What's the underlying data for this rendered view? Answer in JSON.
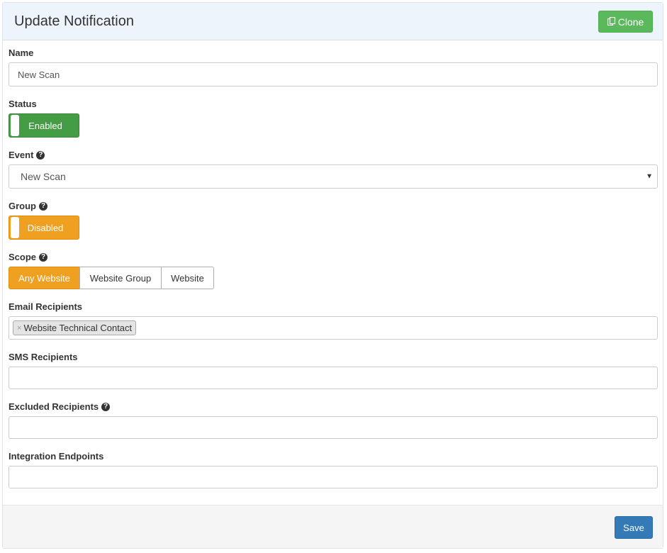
{
  "header": {
    "title": "Update Notification",
    "clone_label": "Clone"
  },
  "fields": {
    "name": {
      "label": "Name",
      "value": "New Scan"
    },
    "status": {
      "label": "Status",
      "toggle_label": "Enabled"
    },
    "event": {
      "label": "Event",
      "value": "New Scan"
    },
    "group": {
      "label": "Group",
      "toggle_label": "Disabled"
    },
    "scope": {
      "label": "Scope",
      "options": [
        "Any Website",
        "Website Group",
        "Website"
      ],
      "selected": "Any Website"
    },
    "email_recipients": {
      "label": "Email Recipients",
      "tags": [
        "Website Technical Contact"
      ]
    },
    "sms_recipients": {
      "label": "SMS Recipients"
    },
    "excluded_recipients": {
      "label": "Excluded Recipients"
    },
    "integration_endpoints": {
      "label": "Integration Endpoints"
    }
  },
  "footer": {
    "save_label": "Save"
  },
  "colors": {
    "success": "#5cb85c",
    "enabled": "#449d44",
    "warning": "#f0a020",
    "primary": "#337ab7",
    "header_bg": "#eef4fc"
  },
  "icons": {
    "clone": "clone-icon",
    "help": "question-circle-icon",
    "dropdown": "caret-down-icon",
    "tag_remove": "close-icon"
  }
}
